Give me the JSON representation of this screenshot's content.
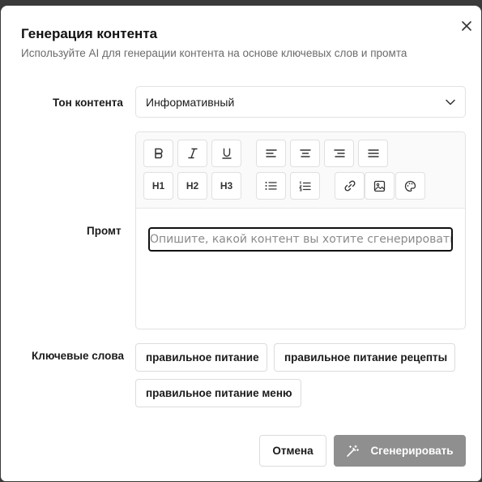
{
  "dialog": {
    "title": "Генерация контента",
    "subtitle": "Используйте AI для генерации контента на основе ключевых слов и промта"
  },
  "form": {
    "tone_label": "Тон контента",
    "tone_value": "Информативный",
    "prompt_label": "Промт",
    "prompt_placeholder": "Опишите, какой контент вы хотите сгенерировать",
    "keywords_label": "Ключевые слова",
    "keywords": [
      "правильное питание",
      "правильное питание рецепты",
      "правильное питание меню"
    ]
  },
  "toolbar": {
    "h1": "H1",
    "h2": "H2",
    "h3": "H3"
  },
  "actions": {
    "cancel_label": "Отмена",
    "generate_label": "Сгенерировать"
  },
  "colors": {
    "generate_bg": "#8f8f8f",
    "backdrop": "#3a3a3a"
  },
  "icons": [
    "close-icon",
    "chevron-down-icon",
    "bold-icon",
    "italic-icon",
    "underline-icon",
    "align-left-icon",
    "align-center-icon",
    "align-right-icon",
    "align-justify-icon",
    "bullet-list-icon",
    "numbered-list-icon",
    "link-icon",
    "image-icon",
    "palette-icon",
    "magic-wand-icon"
  ]
}
